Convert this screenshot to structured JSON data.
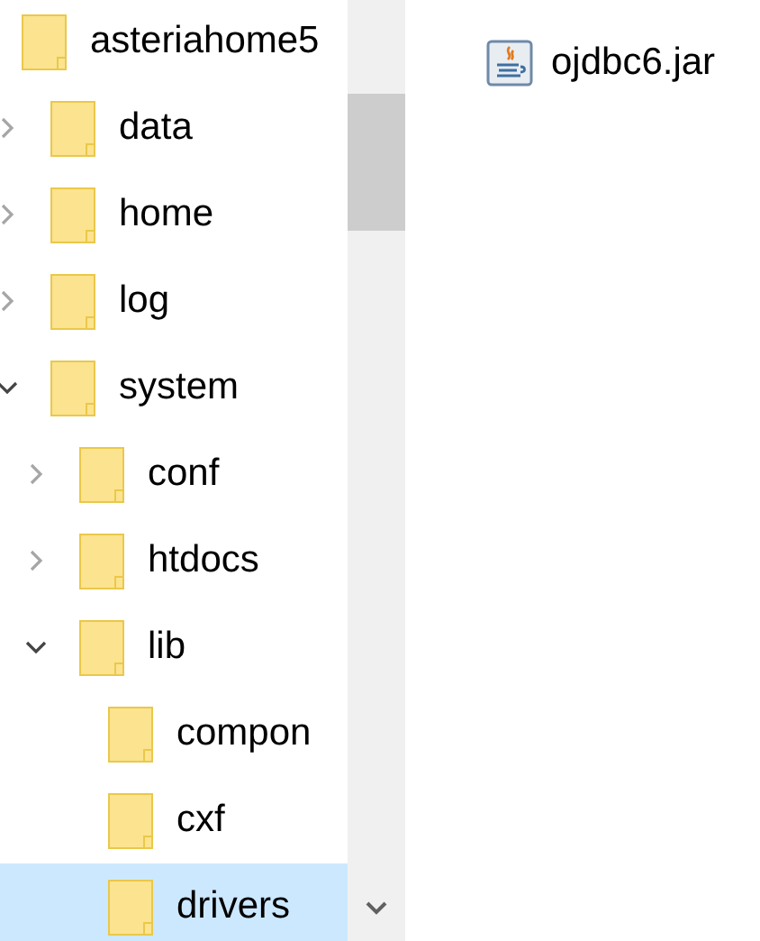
{
  "tree": {
    "label": "asteriahome5",
    "selected": false,
    "children": [
      {
        "label": "data",
        "selected": false,
        "expanded": false
      },
      {
        "label": "home",
        "selected": false,
        "expanded": false
      },
      {
        "label": "log",
        "selected": false,
        "expanded": false
      },
      {
        "label": "system",
        "selected": false,
        "expanded": true,
        "children": [
          {
            "label": "conf",
            "selected": false,
            "expanded": false
          },
          {
            "label": "htdocs",
            "selected": false,
            "expanded": false
          },
          {
            "label": "lib",
            "selected": false,
            "expanded": true,
            "children": [
              {
                "label": "compon",
                "selected": false
              },
              {
                "label": "cxf",
                "selected": false
              },
              {
                "label": "drivers",
                "selected": true
              }
            ]
          }
        ]
      }
    ]
  },
  "files": [
    {
      "name": "ojdbc6.jar"
    }
  ]
}
